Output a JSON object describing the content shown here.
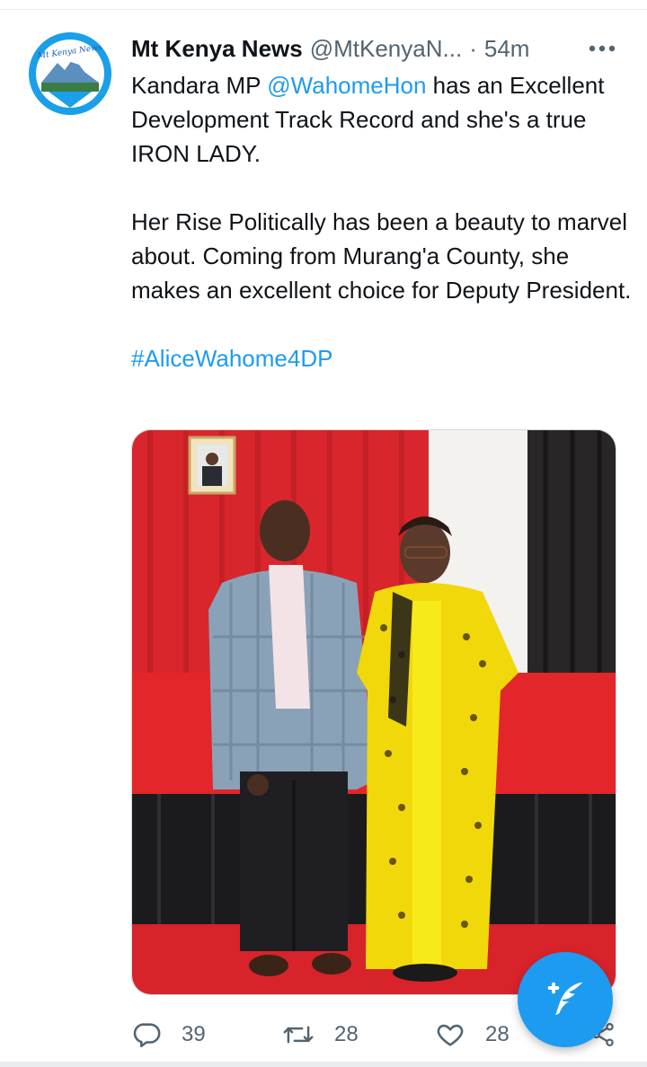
{
  "tweet": {
    "author": {
      "display_name": "Mt Kenya News",
      "handle": "@MtKenyaN...",
      "time": "54m",
      "avatar_logo_text": "Mt Kenya News"
    },
    "text": {
      "p1_prefix": "Kandara MP ",
      "p1_mention": "@WahomeHon",
      "p1_suffix": " has an Excellent Development Track Record and she's a true IRON LADY.",
      "p2": "Her Rise Politically has been a beauty to marvel about. Coming from Murang'a County, she makes an excellent choice for Deputy President.",
      "hashtag": "#AliceWahome4DP"
    },
    "actions": {
      "reply_count": "39",
      "retweet_count": "28",
      "like_count": "28"
    }
  },
  "icons": {
    "more": "more-horizontal-icon",
    "reply": "reply-icon",
    "retweet": "retweet-icon",
    "like": "heart-icon",
    "share": "share-icon",
    "compose": "compose-tweet-icon"
  },
  "colors": {
    "accent": "#1d9bf0",
    "text": "#0f1419",
    "secondary": "#536471"
  }
}
